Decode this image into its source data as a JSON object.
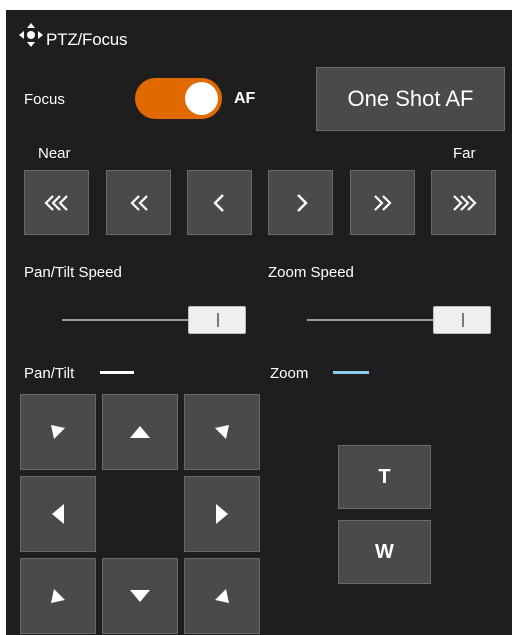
{
  "panel": {
    "title": "PTZ/Focus",
    "title_icon": "move-arrows-icon"
  },
  "focus": {
    "label": "Focus",
    "mode_label": "AF",
    "toggle_on": true,
    "one_shot_label": "One Shot AF",
    "near_label": "Near",
    "far_label": "Far",
    "buttons": [
      {
        "name": "focus-near-fast-button",
        "icon": "triple-chevron-left-icon"
      },
      {
        "name": "focus-near-medium-button",
        "icon": "double-chevron-left-icon"
      },
      {
        "name": "focus-near-slow-button",
        "icon": "chevron-left-icon"
      },
      {
        "name": "focus-far-slow-button",
        "icon": "chevron-right-icon"
      },
      {
        "name": "focus-far-medium-button",
        "icon": "double-chevron-right-icon"
      },
      {
        "name": "focus-far-fast-button",
        "icon": "triple-chevron-right-icon"
      }
    ]
  },
  "speed": {
    "pan_tilt_label": "Pan/Tilt Speed",
    "pan_tilt_value": 0.83,
    "zoom_label": "Zoom Speed",
    "zoom_value": 0.83
  },
  "pan_tilt": {
    "label": "Pan/Tilt",
    "legend_color": "#ffffff",
    "directions": [
      "up-left",
      "up",
      "up-right",
      "left",
      "right",
      "down-left",
      "down",
      "down-right"
    ]
  },
  "zoom": {
    "label": "Zoom",
    "legend_color": "#8ccbea",
    "tele_label": "T",
    "wide_label": "W"
  },
  "colors": {
    "background": "#1e1e1e",
    "accent": "#e06a00",
    "button": "#4a4a4a"
  }
}
